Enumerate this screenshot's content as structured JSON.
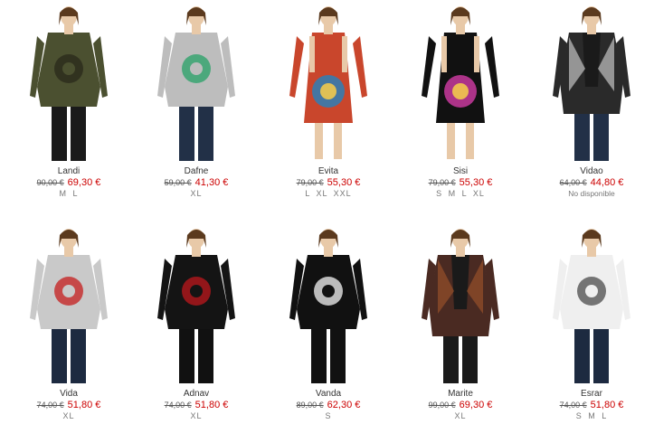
{
  "products": [
    {
      "name": "Landi",
      "old_price": "90,00 €",
      "price": "69,30 €",
      "sizes": "M L",
      "colors": {
        "garment": "#4b5030",
        "accent": "#2a2a1c",
        "skirt": "#1a1a1a",
        "kind": "sweater"
      }
    },
    {
      "name": "Dafne",
      "old_price": "59,00 €",
      "price": "41,30 €",
      "sizes": "XL",
      "colors": {
        "garment": "#bdbdbd",
        "accent": "#2fa36b",
        "skirt": "#223047",
        "kind": "sweater"
      }
    },
    {
      "name": "Evita",
      "old_price": "79,00 €",
      "price": "55,30 €",
      "sizes": "L XL XXL",
      "colors": {
        "garment": "#c9462c",
        "accent": "#2d7fb7",
        "skirt": "#c9462c",
        "kind": "dress"
      }
    },
    {
      "name": "Sisi",
      "old_price": "79,00 €",
      "price": "55,30 €",
      "sizes": "S M L XL",
      "colors": {
        "garment": "#111111",
        "accent": "#c83a9d",
        "skirt": "#7b3fa8",
        "kind": "dress"
      }
    },
    {
      "name": "Vidao",
      "old_price": "64,00 €",
      "price": "44,80 €",
      "sizes": "No disponible",
      "colors": {
        "garment": "#2a2a2a",
        "accent": "#dddddd",
        "skirt": "#223047",
        "kind": "cardigan"
      }
    },
    {
      "name": "Vida",
      "old_price": "74,00 €",
      "price": "51,80 €",
      "sizes": "XL",
      "colors": {
        "garment": "#c9c9c9",
        "accent": "#c62828",
        "skirt": "#1d2a40",
        "kind": "sweater"
      }
    },
    {
      "name": "Adnav",
      "old_price": "74,00 €",
      "price": "51,80 €",
      "sizes": "XL",
      "colors": {
        "garment": "#141414",
        "accent": "#b3161b",
        "skirt": "#111111",
        "kind": "sweater"
      }
    },
    {
      "name": "Vanda",
      "old_price": "89,00 €",
      "price": "62,30 €",
      "sizes": "S",
      "colors": {
        "garment": "#111111",
        "accent": "#e6e6e6",
        "skirt": "#111111",
        "kind": "sweater"
      }
    },
    {
      "name": "Marite",
      "old_price": "99,00 €",
      "price": "69,30 €",
      "sizes": "XL",
      "colors": {
        "garment": "#4a2a22",
        "accent": "#a4562c",
        "skirt": "#1a1a1a",
        "kind": "cardigan"
      }
    },
    {
      "name": "Esrar",
      "old_price": "74,00 €",
      "price": "51,80 €",
      "sizes": "S M L",
      "colors": {
        "garment": "#efefef",
        "accent": "#555555",
        "skirt": "#1d2a40",
        "kind": "sweater"
      }
    }
  ]
}
